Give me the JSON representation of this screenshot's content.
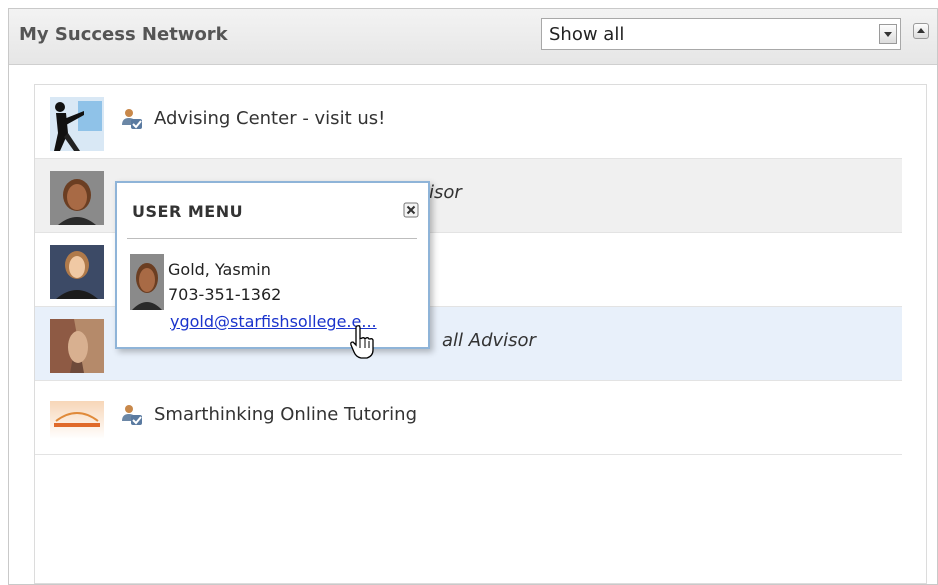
{
  "panel": {
    "title": "My Success Network",
    "filter_value": "Show all"
  },
  "rows": [
    {
      "label": "Advising Center - visit us!",
      "thumb": "silhouette-photo"
    },
    {
      "label": "isor",
      "thumb": "woman-photo"
    },
    {
      "label": "",
      "thumb": "woman-photo-2"
    },
    {
      "label": "all Advisor",
      "thumb": "abstract-photo"
    },
    {
      "label": "Smarthinking Online Tutoring",
      "thumb": "smarthinking-logo"
    }
  ],
  "user_menu": {
    "title": "USER MENU",
    "name": "Gold, Yasmin",
    "phone": "703-351-1362",
    "email": "ygold@starfishsollege.e..."
  },
  "colors": {
    "row_hover": "#e8f0fa",
    "menu_border": "#8fb4d8",
    "link": "#1a33cc"
  },
  "icons": [
    "people-icon",
    "close-icon",
    "hand-cursor-icon",
    "collapse-icon",
    "dropdown-arrow-icon"
  ]
}
